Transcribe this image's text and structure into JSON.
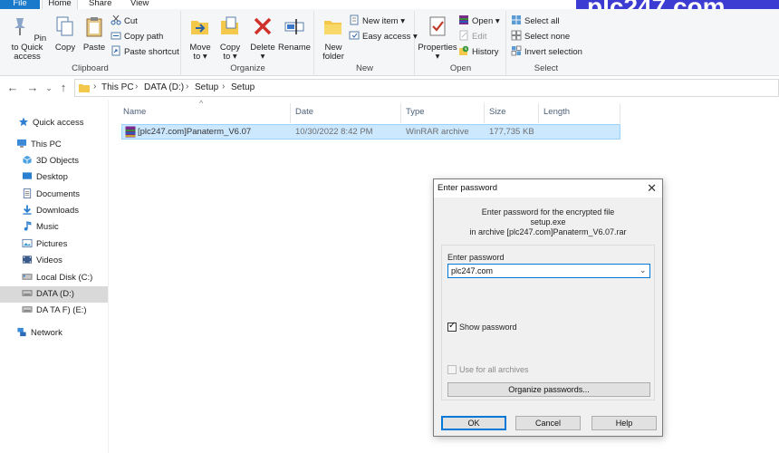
{
  "ribbon": {
    "tabs": [
      "File",
      "Home",
      "Share",
      "View"
    ],
    "clipboard": {
      "pin_label": "Pin to Quick access",
      "copy_label": "Copy",
      "paste_label": "Paste",
      "cut_label": "Cut",
      "copy_path_label": "Copy path",
      "paste_shortcut_label": "Paste shortcut",
      "group_label": "Clipboard"
    },
    "organize": {
      "move_to_label": "Move to",
      "copy_to_label": "Copy to",
      "delete_label": "Delete",
      "rename_label": "Rename",
      "group_label": "Organize"
    },
    "new": {
      "new_folder_label": "New folder",
      "new_item_label": "New item",
      "easy_access_label": "Easy access",
      "group_label": "New"
    },
    "open": {
      "properties_label": "Properties",
      "open_label": "Open",
      "edit_label": "Edit",
      "history_label": "History",
      "group_label": "Open"
    },
    "select": {
      "select_all_label": "Select all",
      "select_none_label": "Select none",
      "invert_label": "Invert selection",
      "group_label": "Select"
    }
  },
  "watermark": "plc247.com",
  "address": {
    "crumbs": [
      "This PC",
      "DATA (D:)",
      "Setup",
      "Setup"
    ]
  },
  "navpane": {
    "items": [
      {
        "label": "Quick access",
        "icon": "star-icon"
      },
      {
        "label": "This PC",
        "icon": "pc-icon"
      },
      {
        "label": "3D Objects",
        "icon": "cube-icon"
      },
      {
        "label": "Desktop",
        "icon": "desktop-icon"
      },
      {
        "label": "Documents",
        "icon": "document-icon"
      },
      {
        "label": "Downloads",
        "icon": "download-icon"
      },
      {
        "label": "Music",
        "icon": "music-icon"
      },
      {
        "label": "Pictures",
        "icon": "picture-icon"
      },
      {
        "label": "Videos",
        "icon": "video-icon"
      },
      {
        "label": "Local Disk (C:)",
        "icon": "drive-icon"
      },
      {
        "label": "DATA (D:)",
        "icon": "drive-icon"
      },
      {
        "label": "DA TA F) (E:)",
        "icon": "drive-icon"
      },
      {
        "label": "Network",
        "icon": "network-icon"
      }
    ]
  },
  "filelist": {
    "columns": [
      "Name",
      "Date",
      "Type",
      "Size",
      "Length"
    ],
    "rows": [
      {
        "name": "[plc247.com]Panaterm_V6.07",
        "date": "10/30/2022 8:42 PM",
        "type": "WinRAR archive",
        "size": "177,735 KB",
        "length": ""
      }
    ]
  },
  "dialog": {
    "title": "Enter password",
    "message_line1": "Enter password for the encrypted file",
    "message_line2": "setup.exe",
    "message_line3": "in archive [plc247.com]Panaterm_V6.07.rar",
    "password_label": "Enter password",
    "password_value": "plc247.com",
    "show_password_label": "Show password",
    "show_password_checked": true,
    "use_all_label": "Use for all archives",
    "organize_label": "Organize passwords...",
    "ok_label": "OK",
    "cancel_label": "Cancel",
    "help_label": "Help"
  },
  "colors": {
    "file_tab": "#1979ca",
    "watermark_bg": "#3c3cd2",
    "selection_bg": "#cce8ff",
    "focus_border": "#0078d7"
  }
}
